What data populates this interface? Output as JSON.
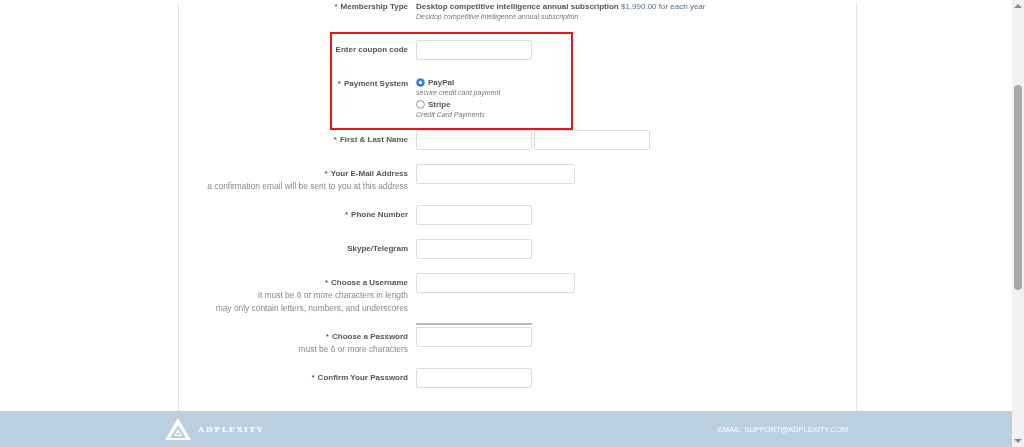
{
  "membership": {
    "label": "Membership Type",
    "required_mark": "*",
    "plan": "Desktop competitive intelligence annual subscription",
    "price": "$1,990.00 for each year",
    "description": "Desktop competitive intelligence annual subscription"
  },
  "highlighted_rows": [
    {
      "kind": "input",
      "label": "Enter coupon code",
      "hints": []
    },
    {
      "kind": "radio",
      "label": "Payment System",
      "required_mark": "*",
      "options": [
        {
          "label": "PayPal",
          "note": "secure credit card payment",
          "selected": true
        },
        {
          "label": "Stripe",
          "note": "Credit Card Payments",
          "selected": false
        }
      ]
    }
  ],
  "rows": [
    {
      "kind": "name-pair",
      "label": "First & Last Name",
      "required_mark": "*",
      "hints": []
    },
    {
      "kind": "wide",
      "label": "Your E-Mail Address",
      "required_mark": "*",
      "hints": [
        "a confirmation email will be sent to you at this address"
      ]
    },
    {
      "kind": "short",
      "label": "Phone Number",
      "required_mark": "*",
      "hints": []
    },
    {
      "kind": "short",
      "label": "Skype/Telegram",
      "hints": []
    },
    {
      "kind": "wide",
      "label": "Choose a Username",
      "required_mark": "*",
      "hints": [
        "it must be 6 or more characters in length",
        "may only contain letters, numbers, and underscores"
      ]
    },
    {
      "kind": "password",
      "label": "Choose a Password",
      "required_mark": "*",
      "hints": [
        "must be 6 or more characters"
      ]
    },
    {
      "kind": "short",
      "label": "Confirm Your Password",
      "required_mark": "*",
      "hints": []
    }
  ],
  "footer": {
    "brand": "ADPLEXITY",
    "email": "EMAIL: SUPPORT@ADPLEXITY.COM"
  }
}
